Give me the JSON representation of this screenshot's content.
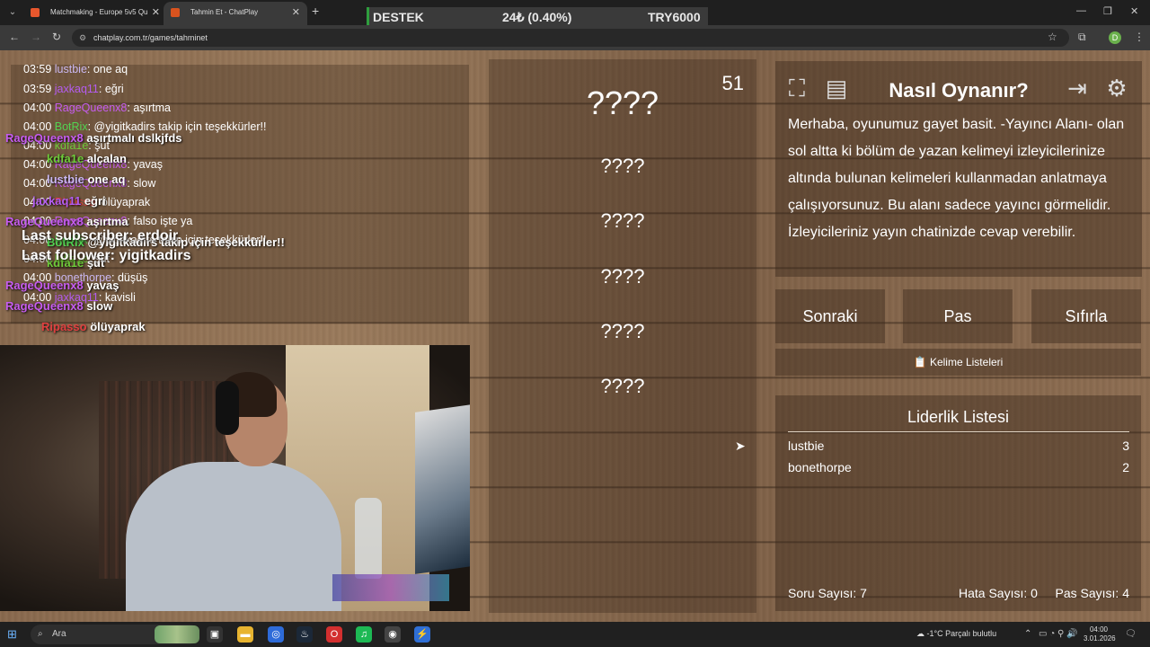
{
  "browser": {
    "tabs": [
      {
        "title": "Matchmaking - Europe 5v5 Qu",
        "active": false,
        "favicon_color": "#e8572d"
      },
      {
        "title": "Tahmin Et - ChatPlay",
        "active": true,
        "favicon_color": "#d9531e"
      }
    ],
    "ticker": {
      "label": "DESTEK",
      "amount": "24₺ (0.40%)",
      "goal": "TRY6000"
    },
    "url": "chatplay.com.tr/games/tahminet",
    "profile_initial": "D"
  },
  "chat": {
    "messages": [
      {
        "time": "03:59",
        "user": "lustbie",
        "text": "one aq",
        "color": "#c9b7f0"
      },
      {
        "time": "03:59",
        "user": "jaxkaq11",
        "text": "eğri",
        "color": "#b45cf0"
      },
      {
        "time": "04:00",
        "user": "RageQueenx8",
        "text": "aşırtma",
        "color": "#c65cf0"
      },
      {
        "time": "04:00",
        "user": "BotRix",
        "text": "@yigitkadirs takip için teşekkürler!!",
        "color": "#52d452"
      },
      {
        "time": "04:00",
        "user": "kdfa1e",
        "text": "şut",
        "color": "#6ecb3a"
      },
      {
        "time": "04:00",
        "user": "RageQueenx8",
        "text": "yavaş",
        "color": "#c65cf0"
      },
      {
        "time": "04:00",
        "user": "RageQueenx8",
        "text": "slow",
        "color": "#c65cf0"
      },
      {
        "time": "04:00",
        "user": "Ripasso",
        "text": "ölüyaprak",
        "color": "#e04040"
      },
      {
        "time": "04:00",
        "user": "RageQueenx8",
        "text": "falso işte ya",
        "color": "#c65cf0"
      },
      {
        "time": "04:00",
        "user": "BotRix",
        "text": "@yigitkadirs takip için teşekkürler!!",
        "color": "#52d452"
      },
      {
        "time": "04:00",
        "user": "kdfa1e",
        "text": "şut",
        "color": "#6ecb3a"
      },
      {
        "time": "04:00",
        "user": "bonethorpe",
        "text": "düşüş",
        "color": "#c9b7f0"
      },
      {
        "time": "04:00",
        "user": "jaxkaq11",
        "text": "kavisli",
        "color": "#b45cf0"
      }
    ],
    "overlay": [
      {
        "user": "RageQueenx8",
        "text": "aşırtmalı dslkjfds",
        "color": "#c65cf0"
      },
      {
        "user": "kdfa1e",
        "text": "alçalan",
        "color": "#6ecb3a"
      },
      {
        "user": "lustbie",
        "text": "one aq",
        "color": "#c9b7f0"
      },
      {
        "user": "jaxkaq11",
        "text": "eğri",
        "color": "#b45cf0"
      },
      {
        "user": "RageQueenx8",
        "text": "aşırtma",
        "color": "#c65cf0"
      },
      {
        "user": "BotRix",
        "text": "@yigitkadirs takip için teşekkürler!!",
        "color": "#52d452"
      },
      {
        "user": "kdfa1e",
        "text": "şut",
        "color": "#6ecb3a"
      },
      {
        "user": "RageQueenx8",
        "text": "yavaş",
        "color": "#c65cf0"
      },
      {
        "user": "RageQueenx8",
        "text": "slow",
        "color": "#c65cf0"
      },
      {
        "user": "Ripasso",
        "text": "ölüyaprak",
        "color": "#e04040"
      }
    ],
    "last_subscriber": "Last subscriber: erdoir",
    "last_follower": "Last follower: yigitkadirs"
  },
  "game": {
    "timer": "51",
    "main_word": "????",
    "forbidden_words": [
      "????",
      "????",
      "????",
      "????",
      "????"
    ]
  },
  "howto": {
    "title": "Nasıl Oynanır?",
    "text": "Merhaba, oyunumuz gayet basit. -Yayıncı Alanı- olan sol altta ki bölüm de yazan kelimeyi izleyicilerinize altında bulunan kelimeleri kullanmadan anlatmaya çalışıyorsunuz. Bu alanı sadece yayıncı görmelidir. İzleyicileriniz yayın chatinizde cevap verebilir.",
    "icons": [
      "fullscreen-icon",
      "document-icon",
      "exit-icon",
      "gear-icon"
    ]
  },
  "controls": {
    "next": "Sonraki",
    "pass": "Pas",
    "reset": "Sıfırla",
    "word_lists": "Kelime Listeleri"
  },
  "leaderboard": {
    "title": "Liderlik Listesi",
    "rows": [
      {
        "name": "lustbie",
        "score": "3"
      },
      {
        "name": "bonethorpe",
        "score": "2"
      }
    ],
    "question_count": "Soru Sayısı: 7",
    "error_count": "Hata Sayısı: 0",
    "pass_count": "Pas Sayısı: 4"
  },
  "taskbar": {
    "search_placeholder": "Ara",
    "weather": "-1°C  Parçalı bulutlu",
    "time": "04:00",
    "date": "3.01.2026"
  }
}
